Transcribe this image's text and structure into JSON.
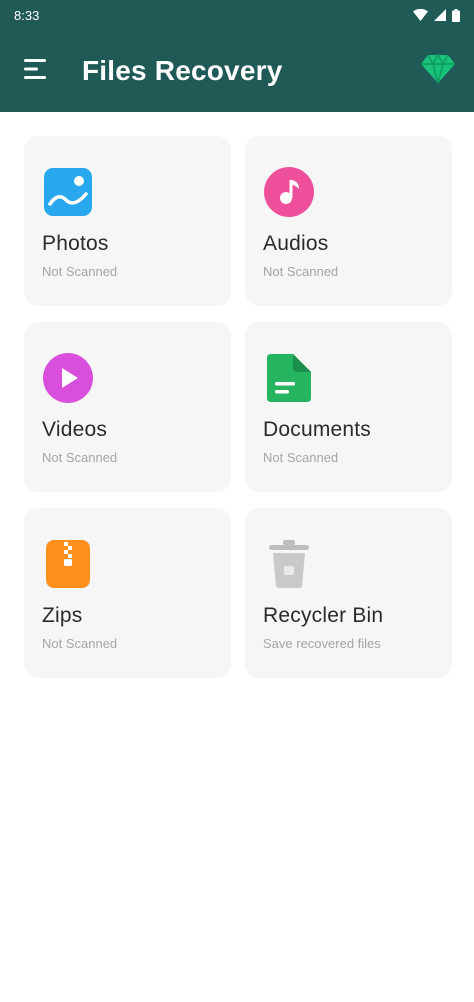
{
  "status": {
    "time": "8:33"
  },
  "app_bar": {
    "title": "Files Recovery"
  },
  "colors": {
    "primary": "#1f5a57",
    "premium": "#19c27a",
    "photos": "#2aa8ef",
    "audios": "#ee4f9a",
    "videos": "#d84fdc",
    "documents": "#25b561",
    "zips": "#ff8f1f",
    "recycler": "#bdbdbd"
  },
  "cards": [
    {
      "label": "Photos",
      "sub": "Not Scanned",
      "icon": "photo-icon"
    },
    {
      "label": "Audios",
      "sub": "Not Scanned",
      "icon": "music-icon"
    },
    {
      "label": "Videos",
      "sub": "Not Scanned",
      "icon": "play-icon"
    },
    {
      "label": "Documents",
      "sub": "Not Scanned",
      "icon": "document-icon"
    },
    {
      "label": "Zips",
      "sub": "Not Scanned",
      "icon": "zip-icon"
    },
    {
      "label": "Recycler Bin",
      "sub": "Save recovered files",
      "icon": "trash-icon"
    }
  ]
}
